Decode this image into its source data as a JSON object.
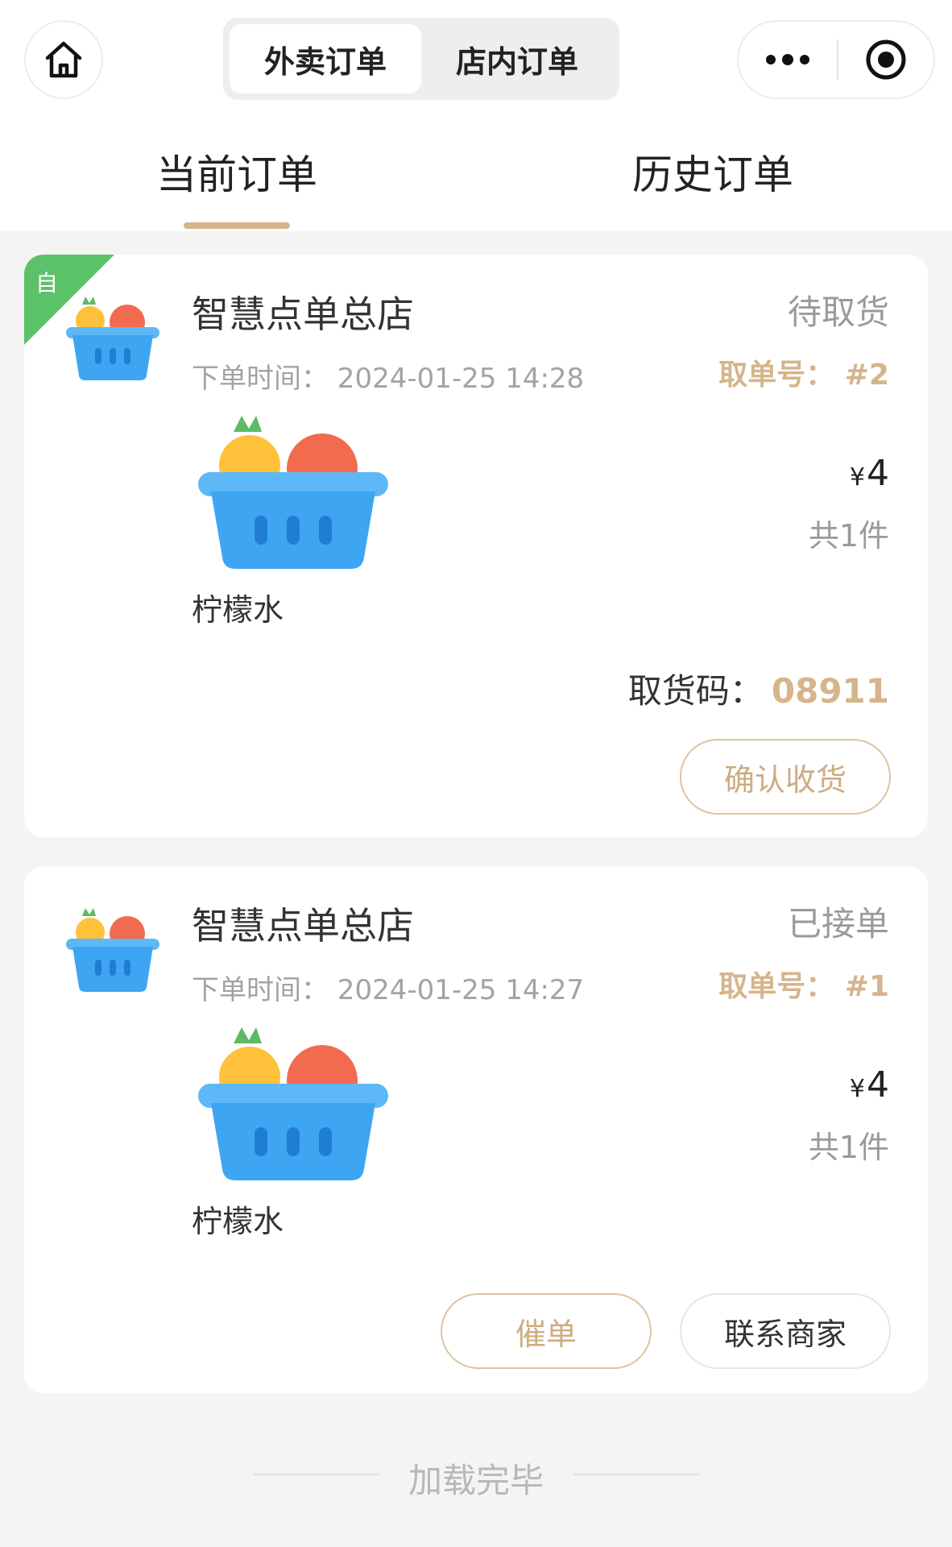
{
  "header": {
    "segment": {
      "delivery_label": "外卖订单",
      "dinein_label": "店内订单",
      "active": "delivery"
    },
    "icons": {
      "home": "home-icon",
      "more": "more-dots-icon",
      "close": "target-circle-icon"
    }
  },
  "tabs": {
    "current": "当前订单",
    "history": "历史订单",
    "active": "current"
  },
  "orders": [
    {
      "badge": "自",
      "store_name": "智慧点单总店",
      "order_time": "下单时间：  2024-01-25 14:28",
      "status": "待取货",
      "pickup_number": "取单号：  #2",
      "item_name": "柠檬水",
      "price_symbol": "¥",
      "price_value": "4",
      "quantity": "共1件",
      "pickup_code_label": "取货码：",
      "pickup_code": "08911",
      "action_label": "确认收货"
    },
    {
      "store_name": "智慧点单总店",
      "order_time": "下单时间：  2024-01-25 14:27",
      "status": "已接单",
      "pickup_number": "取单号：  #1",
      "item_name": "柠檬水",
      "price_symbol": "¥",
      "price_value": "4",
      "quantity": "共1件",
      "urge_label": "催单",
      "contact_label": "联系商家"
    }
  ],
  "footer": {
    "loaded_text": "加载完毕"
  },
  "colors": {
    "accent_gold": "#d6b48c",
    "self_badge_green": "#5cc26a",
    "basket_blue": "#4aa9f3",
    "status_gray": "#9a9a9a"
  }
}
